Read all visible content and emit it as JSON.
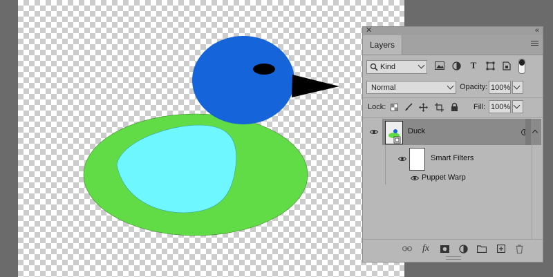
{
  "colors": {
    "workspace": "#6b6b6b",
    "duck_body": "#62dc46",
    "duck_wing": "#6ff7ff",
    "duck_head": "#1564da",
    "duck_eye": "#000000",
    "duck_beak": "#000000",
    "panel_bg": "#b8b8b8",
    "selected_layer": "#8a8a8a"
  },
  "panel": {
    "tab_label": "Layers",
    "filter": {
      "icon": "search-icon",
      "value": "Kind"
    },
    "blend_mode": "Normal",
    "opacity_label": "Opacity:",
    "opacity_value": "100%",
    "lock_label": "Lock:",
    "fill_label": "Fill:",
    "fill_value": "100%",
    "layers": {
      "duck": {
        "name": "Duck"
      },
      "smart_filters": {
        "name": "Smart Filters"
      },
      "puppet_warp": {
        "name": "Puppet Warp"
      }
    },
    "bottom_icons": [
      "link-icon",
      "fx-icon",
      "mask-icon",
      "adjustment-icon",
      "folder-icon",
      "new-layer-icon",
      "trash-icon"
    ]
  }
}
